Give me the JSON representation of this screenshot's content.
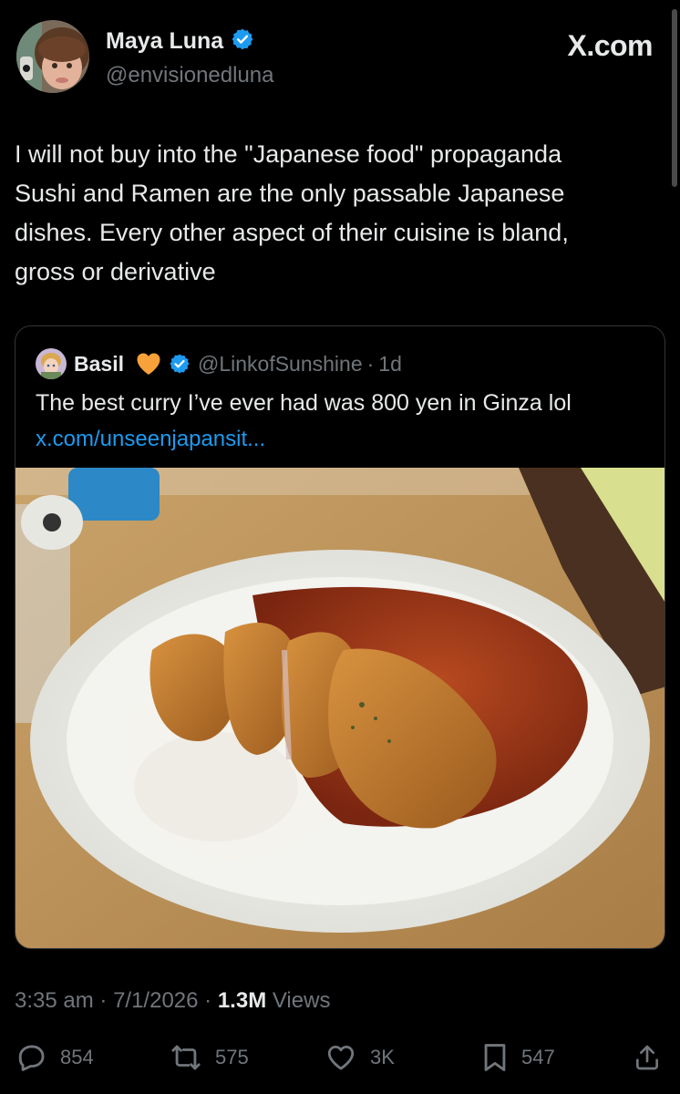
{
  "tweet": {
    "display_name": "Maya Luna",
    "handle": "@envisionedluna",
    "brand": "X.com",
    "text_lines": [
      "I will not buy into the \"Japanese food\" propaganda",
      "Sushi and Ramen are the only passable Japanese",
      "dishes. Every other aspect of their cuisine is bland,",
      "gross or derivative"
    ],
    "time": "3:35 am",
    "date": "7/1/2026",
    "views_count": "1.3M",
    "views_label": "Views",
    "separator": "·"
  },
  "quote": {
    "display_name": "Basil",
    "heart_emoji": "🧡",
    "handle": "@LinkofSunshine",
    "age": "1d",
    "separator": "·",
    "text": "The best curry I’ve ever had was 800 yen in Ginza lol",
    "link": "x.com/unseenjapansit..."
  },
  "actions": {
    "replies": "854",
    "reposts": "575",
    "likes": "3K",
    "bookmarks": "547"
  },
  "colors": {
    "background": "#000000",
    "text": "#e7e9ea",
    "muted": "#71767b",
    "link": "#1d9bf0",
    "verified": "#1d9bf0",
    "border": "#333639"
  },
  "icons": {
    "verified": "verified-badge-icon",
    "reply": "reply-bubble-icon",
    "repost": "repost-arrows-icon",
    "like": "heart-icon",
    "bookmark": "bookmark-icon",
    "share": "share-upload-icon"
  }
}
